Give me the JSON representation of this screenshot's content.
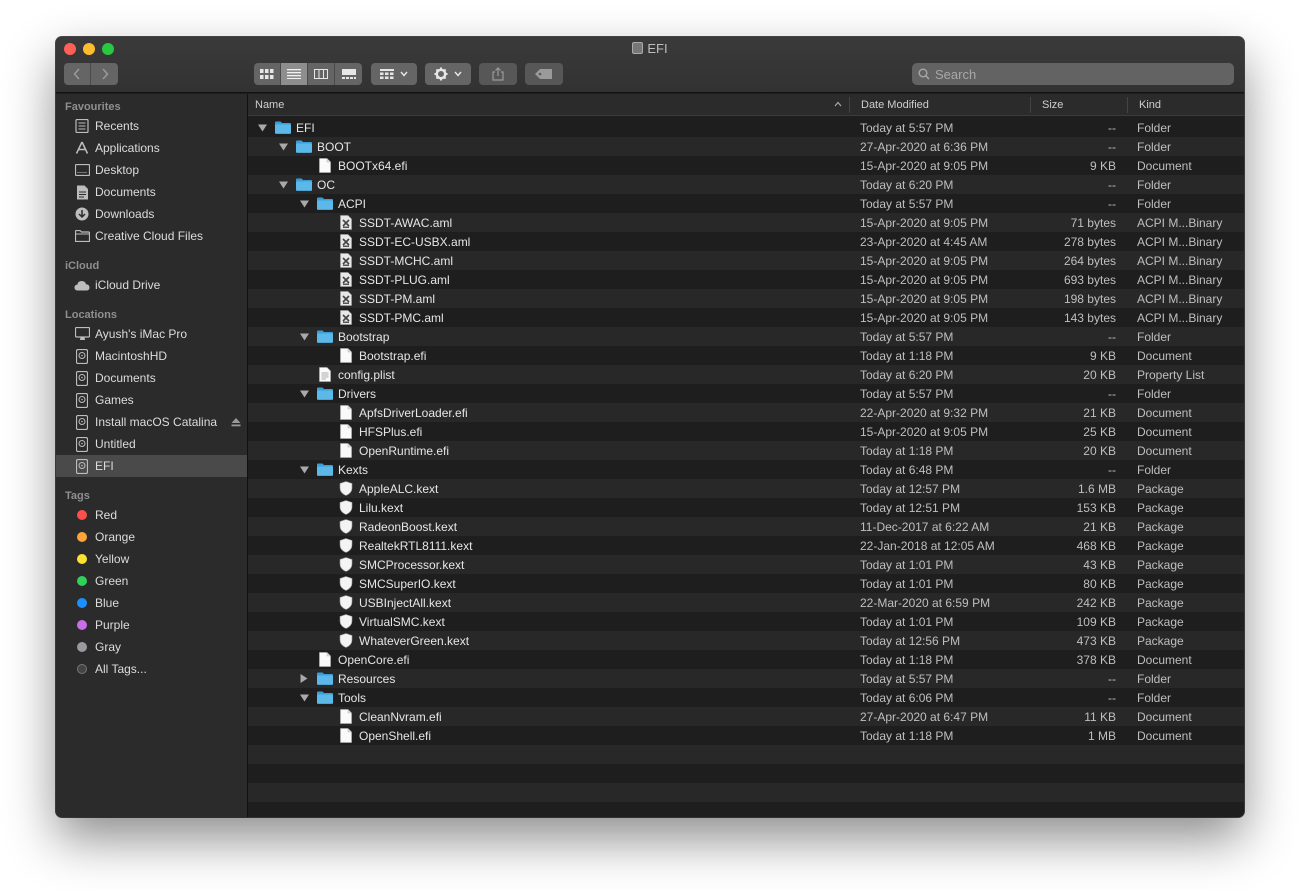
{
  "window": {
    "title": "EFI"
  },
  "toolbar": {
    "search_placeholder": "Search"
  },
  "sidebar": {
    "favourites_header": "Favourites",
    "favourites": [
      {
        "label": "Recents",
        "icon": "recents-icon"
      },
      {
        "label": "Applications",
        "icon": "applications-icon"
      },
      {
        "label": "Desktop",
        "icon": "desktop-icon"
      },
      {
        "label": "Documents",
        "icon": "documents-icon"
      },
      {
        "label": "Downloads",
        "icon": "downloads-icon"
      },
      {
        "label": "Creative Cloud Files",
        "icon": "folder-icon"
      }
    ],
    "icloud_header": "iCloud",
    "icloud": [
      {
        "label": "iCloud Drive",
        "icon": "cloud-icon"
      }
    ],
    "locations_header": "Locations",
    "locations": [
      {
        "label": "Ayush's iMac Pro",
        "icon": "computer-icon"
      },
      {
        "label": "MacintoshHD",
        "icon": "disk-icon"
      },
      {
        "label": "Documents",
        "icon": "disk-icon"
      },
      {
        "label": "Games",
        "icon": "disk-icon"
      },
      {
        "label": "Install macOS Catalina",
        "icon": "disk-icon"
      },
      {
        "label": "Untitled",
        "icon": "disk-icon"
      },
      {
        "label": "EFI",
        "icon": "disk-icon"
      }
    ],
    "tags_header": "Tags",
    "tags": [
      {
        "label": "Red",
        "color": "#fe4f4a"
      },
      {
        "label": "Orange",
        "color": "#fda43a"
      },
      {
        "label": "Yellow",
        "color": "#fee230"
      },
      {
        "label": "Green",
        "color": "#2fd158"
      },
      {
        "label": "Blue",
        "color": "#1c8ffd"
      },
      {
        "label": "Purple",
        "color": "#c86ee8"
      },
      {
        "label": "Gray",
        "color": "#9a9a9e"
      },
      {
        "label": "All Tags...",
        "color": "#555555"
      }
    ]
  },
  "columns": {
    "name": "Name",
    "date": "Date Modified",
    "size": "Size",
    "kind": "Kind"
  },
  "files": [
    {
      "name": "EFI",
      "date": "Today at 5:57 PM",
      "size": "--",
      "kind": "Folder",
      "depth": 0,
      "icon": "folder-icon",
      "disclosure": "open"
    },
    {
      "name": "BOOT",
      "date": "27-Apr-2020 at 6:36 PM",
      "size": "--",
      "kind": "Folder",
      "depth": 1,
      "icon": "folder-icon",
      "disclosure": "open"
    },
    {
      "name": "BOOTx64.efi",
      "date": "15-Apr-2020 at 9:05 PM",
      "size": "9 KB",
      "kind": "Document",
      "depth": 2,
      "icon": "document-icon",
      "disclosure": "none"
    },
    {
      "name": "OC",
      "date": "Today at 6:20 PM",
      "size": "--",
      "kind": "Folder",
      "depth": 1,
      "icon": "folder-icon",
      "disclosure": "open"
    },
    {
      "name": "ACPI",
      "date": "Today at 5:57 PM",
      "size": "--",
      "kind": "Folder",
      "depth": 2,
      "icon": "folder-icon",
      "disclosure": "open"
    },
    {
      "name": "SSDT-AWAC.aml",
      "date": "15-Apr-2020 at 9:05 PM",
      "size": "71 bytes",
      "kind": "ACPI M...Binary",
      "depth": 3,
      "icon": "aml-file-icon",
      "disclosure": "none"
    },
    {
      "name": "SSDT-EC-USBX.aml",
      "date": "23-Apr-2020 at 4:45 AM",
      "size": "278 bytes",
      "kind": "ACPI M...Binary",
      "depth": 3,
      "icon": "aml-file-icon",
      "disclosure": "none"
    },
    {
      "name": "SSDT-MCHC.aml",
      "date": "15-Apr-2020 at 9:05 PM",
      "size": "264 bytes",
      "kind": "ACPI M...Binary",
      "depth": 3,
      "icon": "aml-file-icon",
      "disclosure": "none"
    },
    {
      "name": "SSDT-PLUG.aml",
      "date": "15-Apr-2020 at 9:05 PM",
      "size": "693 bytes",
      "kind": "ACPI M...Binary",
      "depth": 3,
      "icon": "aml-file-icon",
      "disclosure": "none"
    },
    {
      "name": "SSDT-PM.aml",
      "date": "15-Apr-2020 at 9:05 PM",
      "size": "198 bytes",
      "kind": "ACPI M...Binary",
      "depth": 3,
      "icon": "aml-file-icon",
      "disclosure": "none"
    },
    {
      "name": "SSDT-PMC.aml",
      "date": "15-Apr-2020 at 9:05 PM",
      "size": "143 bytes",
      "kind": "ACPI M...Binary",
      "depth": 3,
      "icon": "aml-file-icon",
      "disclosure": "none"
    },
    {
      "name": "Bootstrap",
      "date": "Today at 5:57 PM",
      "size": "--",
      "kind": "Folder",
      "depth": 2,
      "icon": "folder-icon",
      "disclosure": "open"
    },
    {
      "name": "Bootstrap.efi",
      "date": "Today at 1:18 PM",
      "size": "9 KB",
      "kind": "Document",
      "depth": 3,
      "icon": "document-icon",
      "disclosure": "none"
    },
    {
      "name": "config.plist",
      "date": "Today at 6:20 PM",
      "size": "20 KB",
      "kind": "Property List",
      "depth": 2,
      "icon": "plist-file-icon",
      "disclosure": "none"
    },
    {
      "name": "Drivers",
      "date": "Today at 5:57 PM",
      "size": "--",
      "kind": "Folder",
      "depth": 2,
      "icon": "folder-icon",
      "disclosure": "open"
    },
    {
      "name": "ApfsDriverLoader.efi",
      "date": "22-Apr-2020 at 9:32 PM",
      "size": "21 KB",
      "kind": "Document",
      "depth": 3,
      "icon": "document-icon",
      "disclosure": "none"
    },
    {
      "name": "HFSPlus.efi",
      "date": "15-Apr-2020 at 9:05 PM",
      "size": "25 KB",
      "kind": "Document",
      "depth": 3,
      "icon": "document-icon",
      "disclosure": "none"
    },
    {
      "name": "OpenRuntime.efi",
      "date": "Today at 1:18 PM",
      "size": "20 KB",
      "kind": "Document",
      "depth": 3,
      "icon": "document-icon",
      "disclosure": "none"
    },
    {
      "name": "Kexts",
      "date": "Today at 6:48 PM",
      "size": "--",
      "kind": "Folder",
      "depth": 2,
      "icon": "folder-icon",
      "disclosure": "open"
    },
    {
      "name": "AppleALC.kext",
      "date": "Today at 12:57 PM",
      "size": "1.6 MB",
      "kind": "Package",
      "depth": 3,
      "icon": "kext-shield-icon",
      "disclosure": "none"
    },
    {
      "name": "Lilu.kext",
      "date": "Today at 12:51 PM",
      "size": "153 KB",
      "kind": "Package",
      "depth": 3,
      "icon": "kext-shield-icon",
      "disclosure": "none"
    },
    {
      "name": "RadeonBoost.kext",
      "date": "11-Dec-2017 at 6:22 AM",
      "size": "21 KB",
      "kind": "Package",
      "depth": 3,
      "icon": "kext-shield-icon",
      "disclosure": "none"
    },
    {
      "name": "RealtekRTL8111.kext",
      "date": "22-Jan-2018 at 12:05 AM",
      "size": "468 KB",
      "kind": "Package",
      "depth": 3,
      "icon": "kext-shield-icon",
      "disclosure": "none"
    },
    {
      "name": "SMCProcessor.kext",
      "date": "Today at 1:01 PM",
      "size": "43 KB",
      "kind": "Package",
      "depth": 3,
      "icon": "kext-shield-icon",
      "disclosure": "none"
    },
    {
      "name": "SMCSuperIO.kext",
      "date": "Today at 1:01 PM",
      "size": "80 KB",
      "kind": "Package",
      "depth": 3,
      "icon": "kext-shield-icon",
      "disclosure": "none"
    },
    {
      "name": "USBInjectAll.kext",
      "date": "22-Mar-2020 at 6:59 PM",
      "size": "242 KB",
      "kind": "Package",
      "depth": 3,
      "icon": "kext-shield-icon",
      "disclosure": "none"
    },
    {
      "name": "VirtualSMC.kext",
      "date": "Today at 1:01 PM",
      "size": "109 KB",
      "kind": "Package",
      "depth": 3,
      "icon": "kext-shield-icon",
      "disclosure": "none"
    },
    {
      "name": "WhateverGreen.kext",
      "date": "Today at 12:56 PM",
      "size": "473 KB",
      "kind": "Package",
      "depth": 3,
      "icon": "kext-shield-icon",
      "disclosure": "none"
    },
    {
      "name": "OpenCore.efi",
      "date": "Today at 1:18 PM",
      "size": "378 KB",
      "kind": "Document",
      "depth": 2,
      "icon": "document-icon",
      "disclosure": "none"
    },
    {
      "name": "Resources",
      "date": "Today at 5:57 PM",
      "size": "--",
      "kind": "Folder",
      "depth": 2,
      "icon": "folder-icon",
      "disclosure": "closed"
    },
    {
      "name": "Tools",
      "date": "Today at 6:06 PM",
      "size": "--",
      "kind": "Folder",
      "depth": 2,
      "icon": "folder-icon",
      "disclosure": "open"
    },
    {
      "name": "CleanNvram.efi",
      "date": "27-Apr-2020 at 6:47 PM",
      "size": "11 KB",
      "kind": "Document",
      "depth": 3,
      "icon": "document-icon",
      "disclosure": "none"
    },
    {
      "name": "OpenShell.efi",
      "date": "Today at 1:18 PM",
      "size": "1 MB",
      "kind": "Document",
      "depth": 3,
      "icon": "document-icon",
      "disclosure": "none"
    }
  ]
}
